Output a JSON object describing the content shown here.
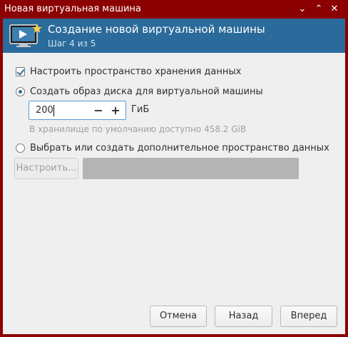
{
  "window": {
    "title": "Новая виртуальная машина",
    "minimize_glyph": "⌄",
    "maximize_glyph": "⌃",
    "close_glyph": "✕"
  },
  "header": {
    "title": "Создание новой виртуальной машины",
    "subtitle": "Шаг 4 из 5",
    "icon": "new-vm-monitor-icon"
  },
  "storage": {
    "enable_label": "Настроить пространство хранения данных",
    "enable_checked": true,
    "create_image_label": "Создать образ диска для виртуальной машины",
    "create_image_selected": true,
    "size_value": "200",
    "size_unit": "ГиБ",
    "decrement_glyph": "−",
    "increment_glyph": "+",
    "available_text": "В хранилище по умолчанию доступно 458.2 GiB",
    "select_custom_label": "Выбрать или создать дополнительное пространство данных",
    "select_custom_selected": false,
    "configure_button_label": "Настроить...",
    "path_value": ""
  },
  "footer": {
    "cancel_label": "Отмена",
    "back_label": "Назад",
    "next_label": "Вперед"
  },
  "colors": {
    "titlebar": "#8b0000",
    "header": "#2a6b9b",
    "accent": "#5b9bd5"
  }
}
